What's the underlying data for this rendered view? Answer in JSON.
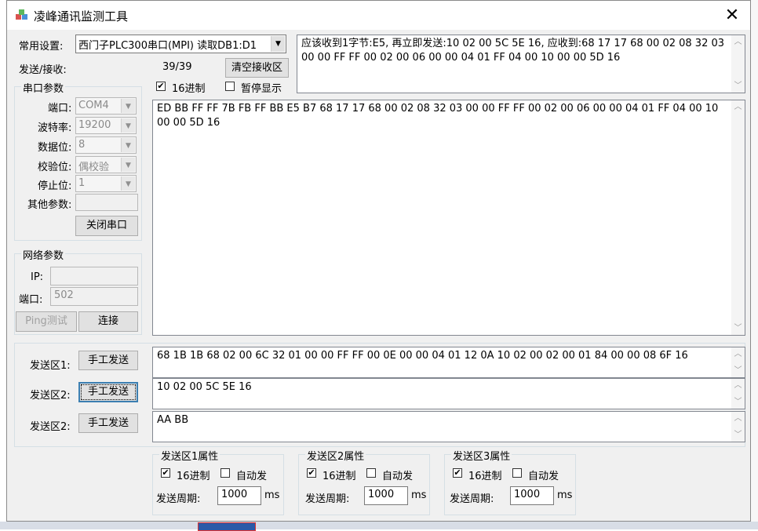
{
  "window": {
    "title": "凌峰通讯监测工具",
    "close_glyph": "✕"
  },
  "common": {
    "label": "常用设置:",
    "value": "西门子PLC300串口(MPI) 读取DB1:D1"
  },
  "stats": {
    "label": "发送/接收:",
    "value": "39/39",
    "clear_label": "清空接收区"
  },
  "options": {
    "hex_label": "16进制",
    "hex_checked": "✔",
    "pause_label": "暂停显示"
  },
  "info_text": "应该收到1字节:E5, 再立即发送:10 02 00 5C 5E 16, 应收到:68 17 17 68 00 02 08 32 03 00 00 FF FF 00 02 00 06 00 00 04 01 FF 04 00 10 00 00 5D 16",
  "receive_text": "ED BB FF FF 7B FB FF BB E5 B7 68 17 17 68 00 02 08 32 03 00 00 FF FF 00 02 00 06 00 00 04 01 FF 04 00 10 00 00 5D 16",
  "serial": {
    "legend": "串口参数",
    "port_label": "端口:",
    "port_value": "COM4",
    "baud_label": "波特率:",
    "baud_value": "19200",
    "databits_label": "数据位:",
    "databits_value": "8",
    "parity_label": "校验位:",
    "parity_value": "偶校验",
    "stopbits_label": "停止位:",
    "stopbits_value": "1",
    "other_label": "其他参数:",
    "other_value": "",
    "close_label": "关闭串口"
  },
  "network": {
    "legend": "网络参数",
    "ip_label": "IP:",
    "ip_value": "",
    "port_label": "端口:",
    "port_value": "502",
    "ping_label": "Ping测试",
    "connect_label": "连接"
  },
  "send_zones": [
    {
      "label": "发送区1:",
      "button": "手工发送",
      "text": "68 1B 1B 68 02 00 6C 32 01 00 00 FF FF 00 0E 00 00 04 01 12 0A 10 02 00 02 00 01 84 00 00 08 6F 16"
    },
    {
      "label": "发送区2:",
      "button": "手工发送",
      "text": "10 02 00 5C 5E 16"
    },
    {
      "label": "发送区2:",
      "button": "手工发送",
      "text": "AA BB"
    }
  ],
  "zone_props": [
    {
      "legend": "发送区1属性",
      "hex_label": "16进制",
      "hex_checked": "✔",
      "auto_label": "自动发",
      "period_label": "发送周期:",
      "period_value": "1000",
      "unit": "ms"
    },
    {
      "legend": "发送区2属性",
      "hex_label": "16进制",
      "hex_checked": "✔",
      "auto_label": "自动发",
      "period_label": "发送周期:",
      "period_value": "1000",
      "unit": "ms"
    },
    {
      "legend": "发送区3属性",
      "hex_label": "16进制",
      "hex_checked": "✔",
      "auto_label": "自动发",
      "period_label": "发送周期:",
      "period_value": "1000",
      "unit": "ms"
    }
  ],
  "icons": {
    "up": "︿",
    "down": "﹀",
    "dropdown": "▼"
  }
}
